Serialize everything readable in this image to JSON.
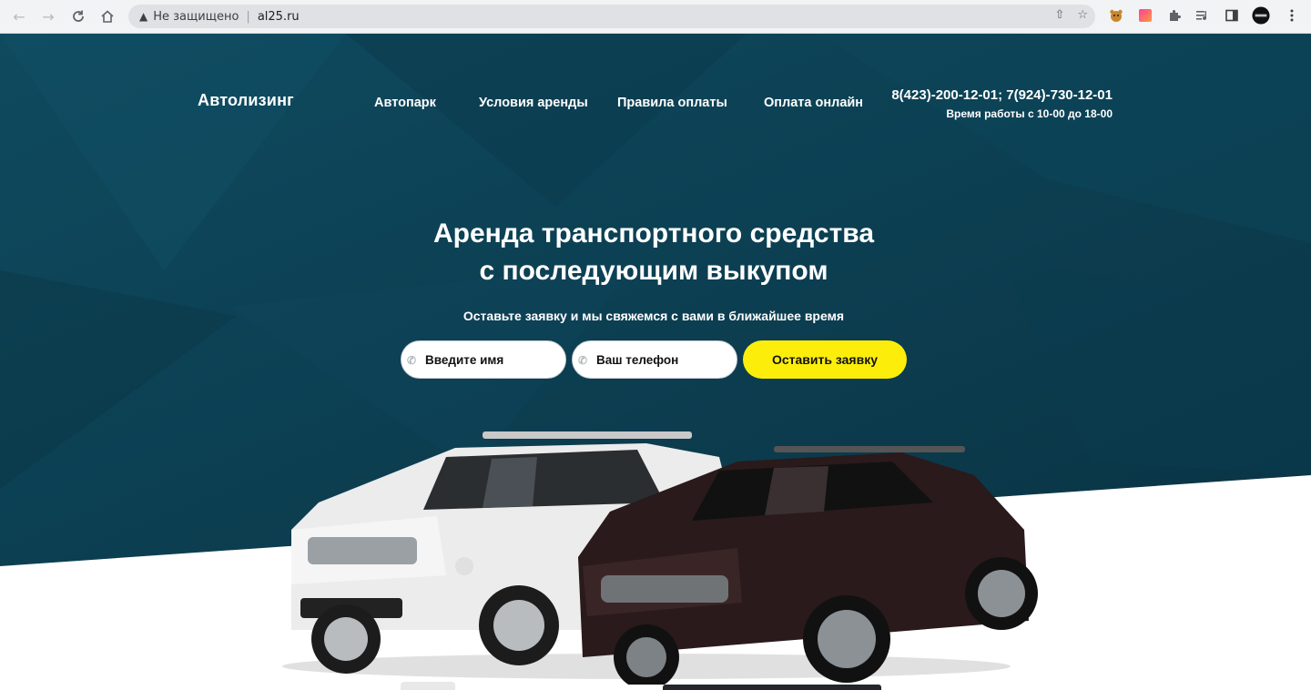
{
  "browser": {
    "security_label": "Не защищено",
    "url": "al25.ru",
    "icons": [
      "back-icon",
      "forward-icon",
      "reload-icon",
      "home-icon",
      "warning-icon",
      "share-icon",
      "star-icon",
      "extension-bear-icon",
      "extension-gradient-icon",
      "puzzle-icon",
      "media-icon",
      "sidebar-icon",
      "profile-icon",
      "menu-dots-icon"
    ]
  },
  "site": {
    "logo": "Автолизинг",
    "nav": [
      "Автопарк",
      "Условия аренды",
      "Правила оплаты",
      "Оплата онлайн"
    ],
    "phone": "8(423)-200-12-01; 7(924)-730-12-01",
    "hours": "Время работы с 10-00 до 18-00"
  },
  "hero": {
    "title_line1": "Аренда транспортного средства",
    "title_line2": "с последующим выкупом",
    "subtitle": "Оставьте заявку и мы свяжемся с вами в ближайшее время",
    "name_placeholder": "Введите имя",
    "phone_placeholder": "Ваш телефон",
    "submit_label": "Оставить заявку"
  },
  "colors": {
    "hero_bg": "#0d4458",
    "accent": "#fcee0a",
    "text_light": "#ffffff"
  }
}
